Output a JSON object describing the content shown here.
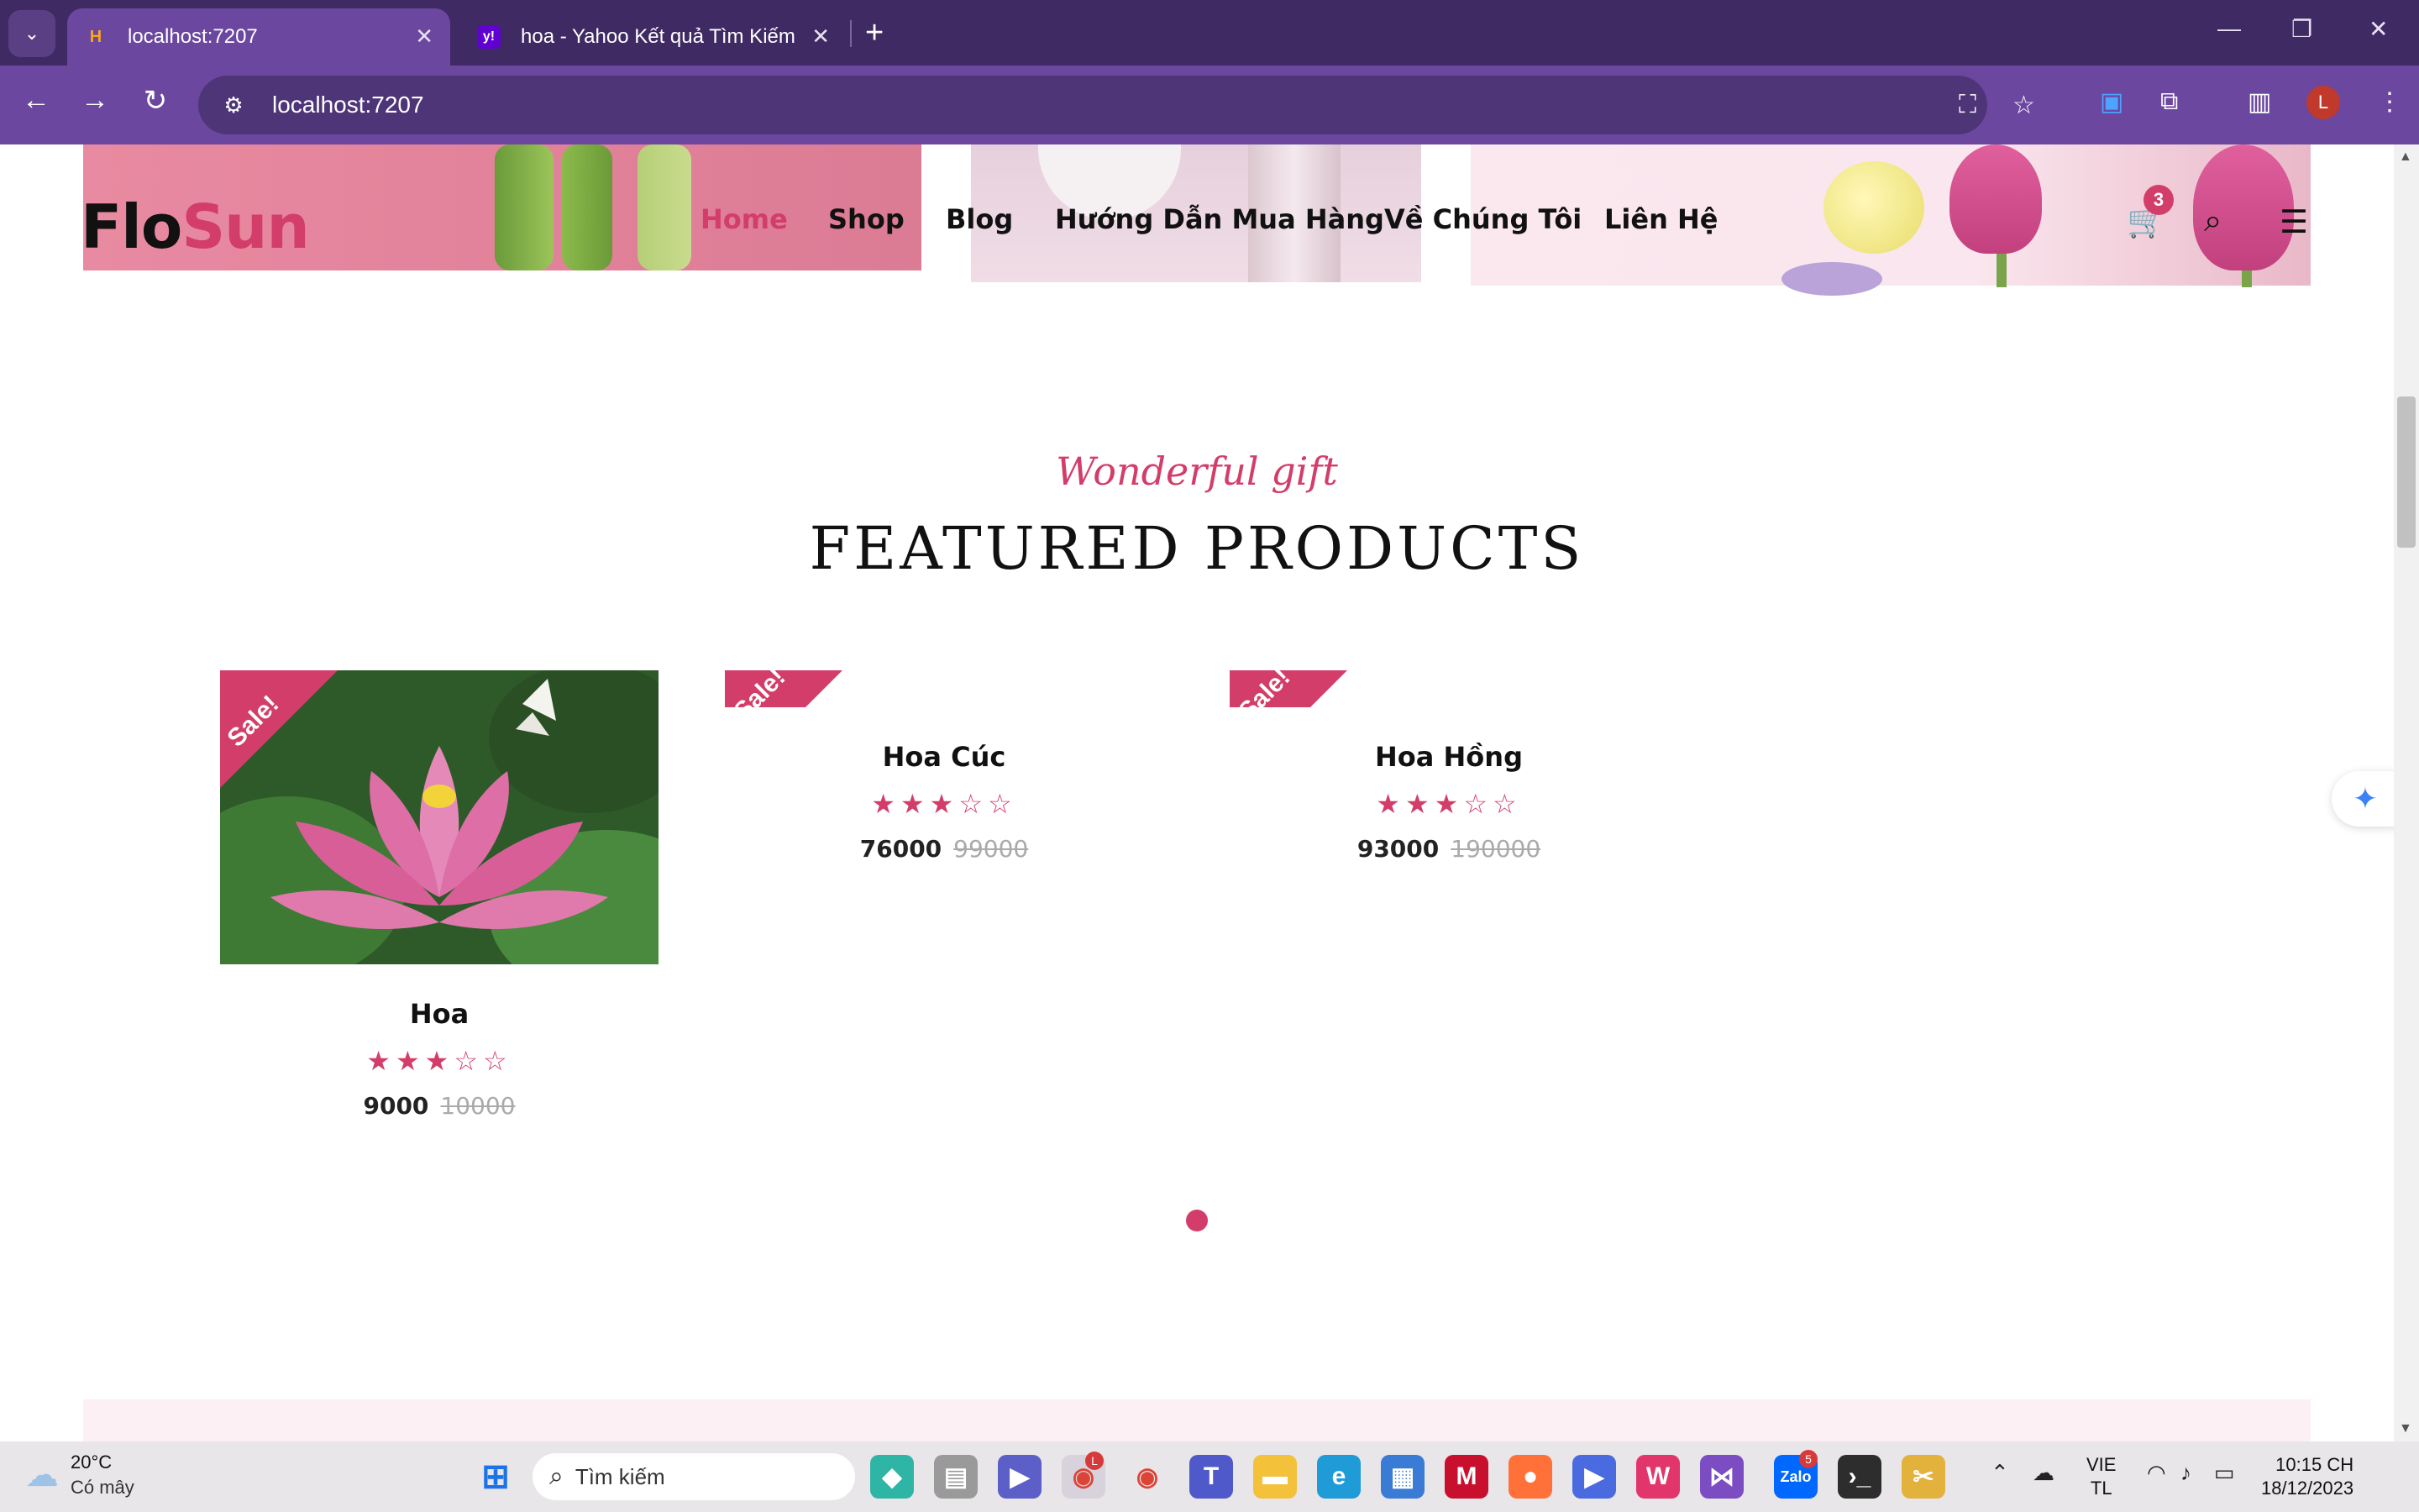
{
  "browser": {
    "tabs": [
      {
        "title": "localhost:7207",
        "favicon": "H",
        "active": true
      },
      {
        "title": "hoa - Yahoo Kết quả Tìm Kiếm Hìn",
        "favicon": "y!",
        "active": false
      }
    ],
    "address": "localhost:7207",
    "profile_initial": "L",
    "colors": {
      "tabbar": "#3f2a63",
      "toolbar": "#6b47a0"
    }
  },
  "site": {
    "logo_part1": "Flo",
    "logo_part2": "Sun",
    "nav": [
      {
        "label": "Home",
        "active": true
      },
      {
        "label": "Shop",
        "active": false
      },
      {
        "label": "Blog",
        "active": false
      },
      {
        "label": "Hướng Dẫn Mua Hàng",
        "active": false
      },
      {
        "label": "Về Chúng Tôi",
        "active": false
      },
      {
        "label": "Liên Hệ",
        "active": false
      }
    ],
    "cart_count": "3",
    "accent": "#d33d6a"
  },
  "section": {
    "subtitle": "Wonderful gift",
    "title": "FEATURED PRODUCTS"
  },
  "products": [
    {
      "name": "Hoa",
      "badge": "Sale!",
      "rating": 3,
      "price": "9000",
      "old_price": "10000"
    },
    {
      "name": "Hoa Cúc",
      "badge": "Sale!",
      "rating": 3,
      "price": "76000",
      "old_price": "99000"
    },
    {
      "name": "Hoa Hồng",
      "badge": "Sale!",
      "rating": 3,
      "price": "93000",
      "old_price": "190000"
    }
  ],
  "stars": {
    "filled": "★★★",
    "empty": "☆☆"
  },
  "taskbar": {
    "weather_temp": "20°C",
    "weather_desc": "Có mây",
    "search_placeholder": "Tìm kiếm",
    "lang_line1": "VIE",
    "lang_line2": "TL",
    "time": "10:15 CH",
    "date": "18/12/2023",
    "chrome_badge": "L",
    "zalo_badge": "5"
  }
}
